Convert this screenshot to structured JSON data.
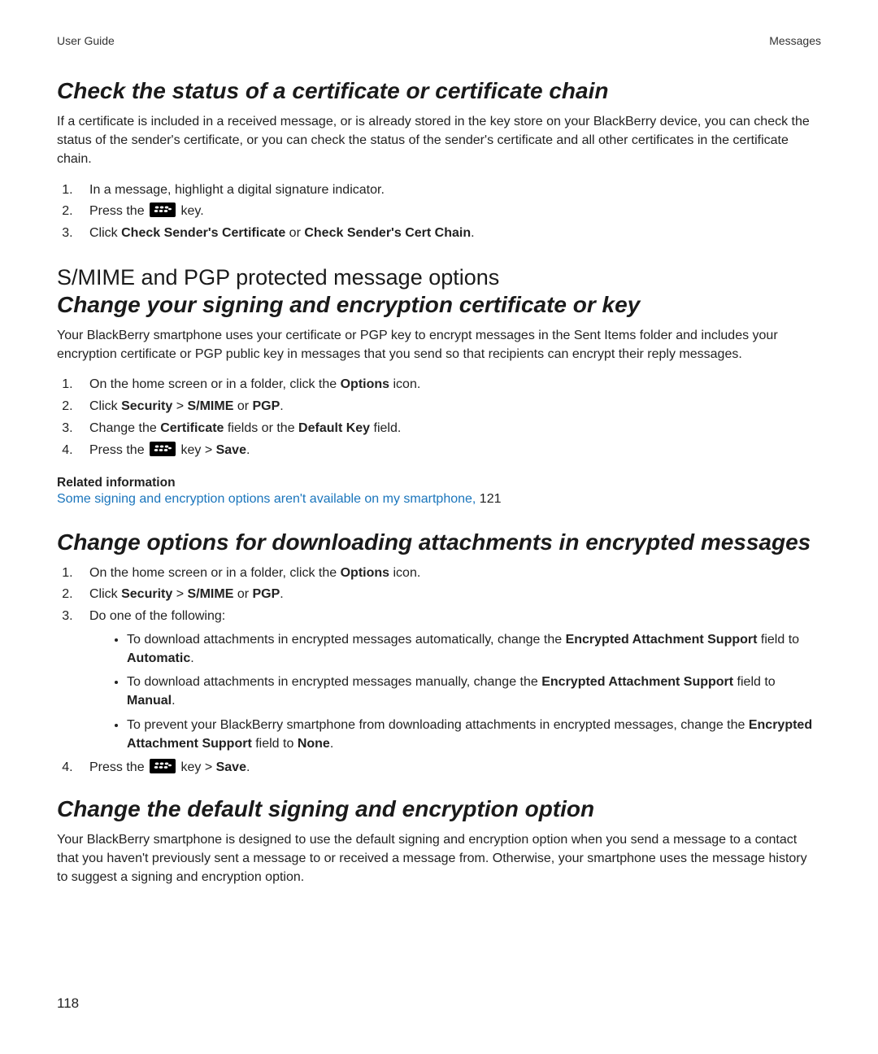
{
  "header": {
    "left": "User Guide",
    "right": "Messages"
  },
  "section1": {
    "heading": "Check the status of a certificate or certificate chain",
    "para": "If a certificate is included in a received message, or is already stored in the key store on your BlackBerry device, you can check the status of the sender's certificate, or you can check the status of the sender's certificate and all other certificates in the certificate chain.",
    "step1": "In a message, highlight a digital signature indicator.",
    "step2_a": "Press the ",
    "step2_b": " key.",
    "step3_a": "Click ",
    "step3_b": "Check Sender's Certificate",
    "step3_c": " or ",
    "step3_d": "Check Sender's Cert Chain",
    "step3_e": "."
  },
  "section2": {
    "heading_plain": "S/MIME and PGP protected message options",
    "heading_italic": "Change your signing and encryption certificate or key",
    "para": "Your BlackBerry smartphone uses your certificate or PGP key to encrypt messages in the Sent Items folder and includes your encryption certificate or PGP public key in messages that you send so that recipients can encrypt their reply messages.",
    "step1_a": "On the home screen or in a folder, click the ",
    "step1_b": "Options",
    "step1_c": " icon.",
    "step2_a": "Click ",
    "step2_b": "Security",
    "step2_c": " > ",
    "step2_d": "S/MIME",
    "step2_e": " or ",
    "step2_f": "PGP",
    "step2_g": ".",
    "step3_a": "Change the ",
    "step3_b": "Certificate",
    "step3_c": " fields or the ",
    "step3_d": "Default Key",
    "step3_e": " field.",
    "step4_a": "Press the ",
    "step4_b": " key > ",
    "step4_c": "Save",
    "step4_d": ".",
    "related_heading": "Related information",
    "related_link": "Some signing and encryption options aren't available on my smartphone,",
    "related_page": " 121"
  },
  "section3": {
    "heading": "Change options for downloading attachments in encrypted messages",
    "step1_a": "On the home screen or in a folder, click the ",
    "step1_b": "Options",
    "step1_c": " icon.",
    "step2_a": "Click ",
    "step2_b": "Security",
    "step2_c": " > ",
    "step2_d": "S/MIME",
    "step2_e": " or ",
    "step2_f": "PGP",
    "step2_g": ".",
    "step3": "Do one of the following:",
    "bul1_a": "To download attachments in encrypted messages automatically, change the ",
    "bul1_b": "Encrypted Attachment Support",
    "bul1_c": " field to ",
    "bul1_d": "Automatic",
    "bul1_e": ".",
    "bul2_a": "To download attachments in encrypted messages manually, change the ",
    "bul2_b": "Encrypted Attachment Support",
    "bul2_c": " field to ",
    "bul2_d": "Manual",
    "bul2_e": ".",
    "bul3_a": "To prevent your BlackBerry smartphone from downloading attachments in encrypted messages, change the ",
    "bul3_b": "Encrypted Attachment Support",
    "bul3_c": " field to ",
    "bul3_d": "None",
    "bul3_e": ".",
    "step4_a": "Press the ",
    "step4_b": " key > ",
    "step4_c": "Save",
    "step4_d": "."
  },
  "section4": {
    "heading": "Change the default signing and encryption option",
    "para": "Your BlackBerry smartphone is designed to use the default signing and encryption option when you send a message to a contact that you haven't previously sent a message to or received a message from. Otherwise, your smartphone uses the message history to suggest a signing and encryption option."
  },
  "page_number": "118"
}
